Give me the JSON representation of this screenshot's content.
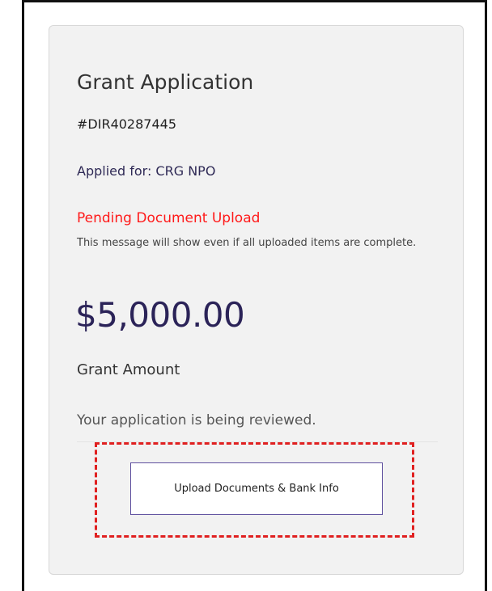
{
  "card": {
    "title": "Grant Application",
    "application_id": "#DIR40287445",
    "applied_for": "Applied for: CRG NPO",
    "status": "Pending Document Upload",
    "status_note": "This message will show even if all uploaded items are complete.",
    "amount": "$5,000.00",
    "amount_label": "Grant Amount",
    "review_message": "Your application is being reviewed.",
    "upload_button_label": "Upload Documents & Bank Info"
  },
  "colors": {
    "status": "#ff1a1a",
    "amount": "#2b2358",
    "highlight": "#e02020",
    "button_border": "#5e4f9e"
  }
}
